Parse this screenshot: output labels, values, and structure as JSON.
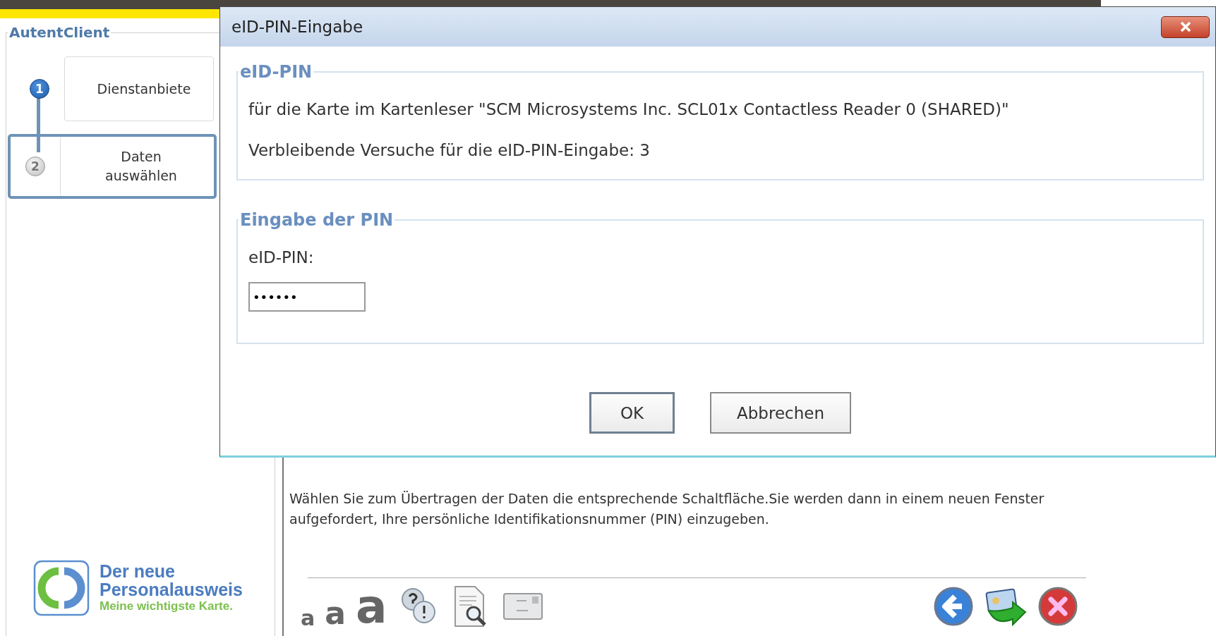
{
  "app": {
    "panel_title": "AutentClient"
  },
  "steps": [
    {
      "number": "1",
      "label": "Dienstanbiete",
      "completed": true,
      "selected": false
    },
    {
      "number": "2",
      "label": "Daten auswählen",
      "completed": false,
      "selected": true
    }
  ],
  "logo": {
    "line_1": "Der neue",
    "line_2": "Personalausweis",
    "tagline": "Meine wichtigste Karte."
  },
  "main": {
    "instruction": "Wählen Sie zum Übertragen der Daten die entsprechende Schaltfläche.Sie werden dann in einem neuen Fenster aufgefordert, Ihre persönliche Identifikationsnummer (PIN) einzugeben."
  },
  "toolbar": {
    "font_size_buttons": [
      {
        "label": "a"
      },
      {
        "label": "a"
      },
      {
        "label": "a"
      }
    ]
  },
  "dialog": {
    "title": "eID-PIN-Eingabe",
    "info_group": {
      "legend": "eID-PIN",
      "lines": [
        "für die Karte im Kartenleser \"SCM Microsystems Inc. SCL01x Contactless Reader 0 (SHARED)\"",
        "Verbleibende Versuche für die eID-PIN-Eingabe: 3"
      ]
    },
    "input_group": {
      "legend": "Eingabe der PIN",
      "label": "eID-PIN:",
      "value": "••••••"
    },
    "buttons": [
      {
        "label": "OK",
        "kind": "default"
      },
      {
        "label": "Abbrechen",
        "kind": "normal"
      }
    ]
  }
}
